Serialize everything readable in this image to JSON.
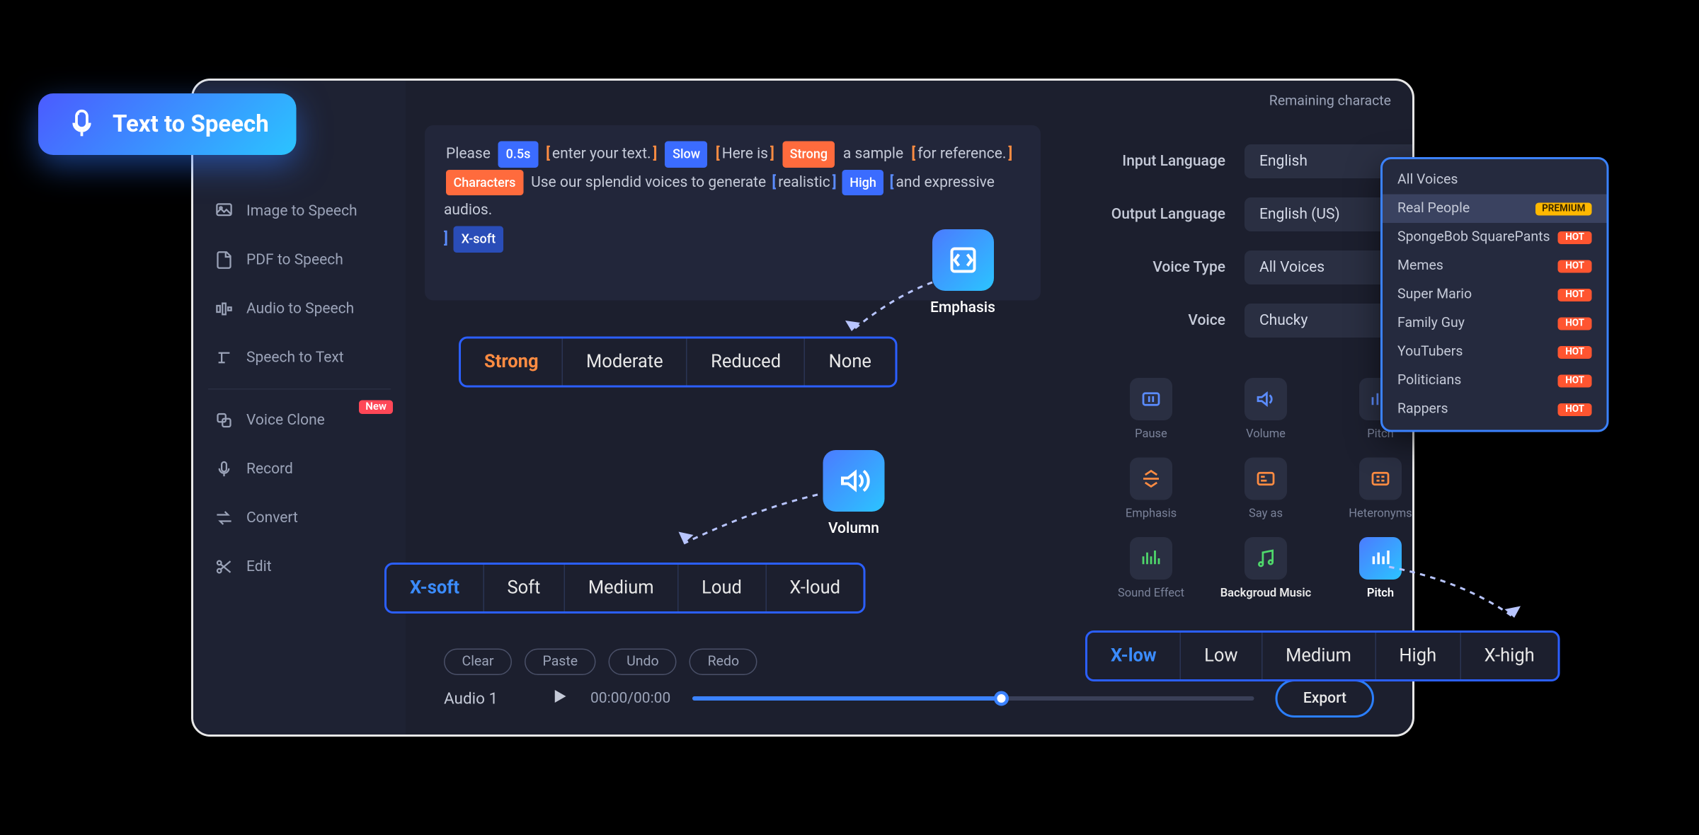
{
  "badge_title": "Text  to Speech",
  "remaining_label": "Remaining characte",
  "sidebar": {
    "items": [
      {
        "label": "Image to Speech"
      },
      {
        "label": "PDF to Speech"
      },
      {
        "label": "Audio to Speech"
      },
      {
        "label": "Speech to Text"
      },
      {
        "label": "Voice Clone",
        "badge": "New"
      },
      {
        "label": "Record"
      },
      {
        "label": "Convert"
      },
      {
        "label": "Edit"
      }
    ]
  },
  "editor": {
    "t1": "Please",
    "tag1": "0.5s",
    "t2": "enter your text.",
    "tag2": "Slow",
    "t3": "Here is",
    "tag3": "Strong",
    "t4": "a sample",
    "t5": "for reference.",
    "tag4": "Characters",
    "t6": "Use our splendid voices to generate",
    "t7": "realistic",
    "tag5": "High",
    "t8": "and expressive audios.",
    "tag6": "X-soft"
  },
  "settings": {
    "rows": [
      {
        "label": "Input Language",
        "value": "English"
      },
      {
        "label": "Output Language",
        "value": "English (US)"
      },
      {
        "label": "Voice Type",
        "value": "All Voices"
      },
      {
        "label": "Voice",
        "value": "Chucky"
      }
    ]
  },
  "effects": [
    {
      "label": "Pause"
    },
    {
      "label": "Volume"
    },
    {
      "label": "Pitch"
    },
    {
      "label": "Emphasis"
    },
    {
      "label": "Say as"
    },
    {
      "label": "Heteronyms"
    },
    {
      "label": "Sound Effect"
    },
    {
      "label": "Backgroud Music"
    },
    {
      "label": "Pitch"
    }
  ],
  "actions": [
    "Clear",
    "Paste",
    "Undo",
    "Redo"
  ],
  "player": {
    "name": "Audio 1",
    "time": "00:00/00:00",
    "export": "Export"
  },
  "callouts": {
    "emphasis": "Emphasis",
    "volume": "Volumn",
    "pitch": "Pitch"
  },
  "emphasis_opts": [
    "Strong",
    "Moderate",
    "Reduced",
    "None"
  ],
  "volume_opts": [
    "X-soft",
    "Soft",
    "Medium",
    "Loud",
    "X-loud"
  ],
  "pitch_opts": [
    "X-low",
    "Low",
    "Medium",
    "High",
    "X-high"
  ],
  "dropdown": [
    {
      "label": "All Voices"
    },
    {
      "label": "Real People",
      "badge": "PREMIUM",
      "sel": true
    },
    {
      "label": "SpongeBob SquarePants",
      "badge": "HOT"
    },
    {
      "label": "Memes",
      "badge": "HOT"
    },
    {
      "label": "Super Mario",
      "badge": "HOT"
    },
    {
      "label": "Family Guy",
      "badge": "HOT"
    },
    {
      "label": "YouTubers",
      "badge": "HOT"
    },
    {
      "label": "Politicians",
      "badge": "HOT"
    },
    {
      "label": "Rappers",
      "badge": "HOT"
    }
  ]
}
